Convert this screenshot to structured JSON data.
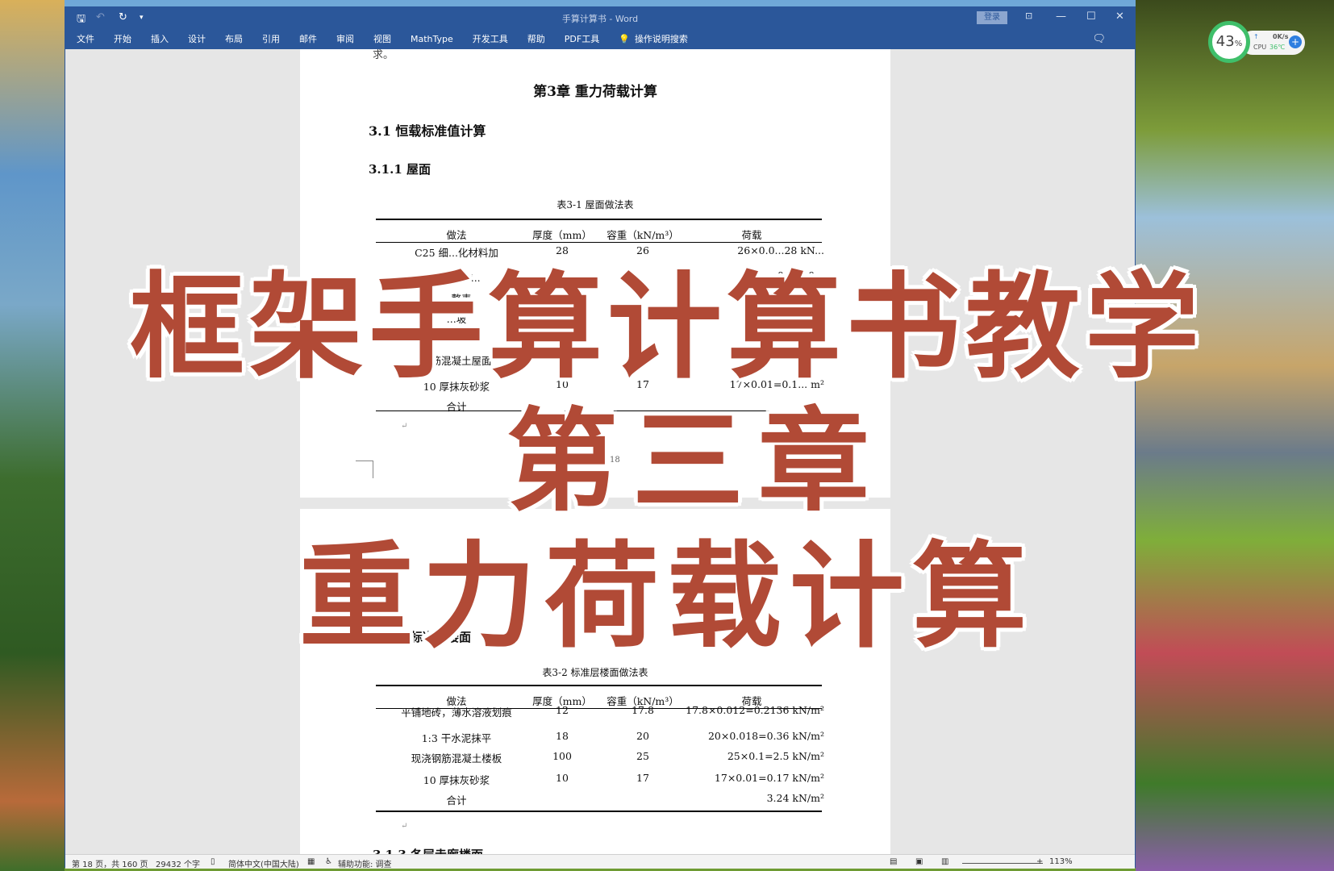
{
  "window": {
    "title": "手算计算书 - Word",
    "login": "登录"
  },
  "tabs": [
    "文件",
    "开始",
    "插入",
    "设计",
    "布局",
    "引用",
    "邮件",
    "审阅",
    "视图",
    "MathType",
    "开发工具",
    "帮助",
    "PDF工具"
  ],
  "tell_me": "操作说明搜索",
  "doc": {
    "prev_line": "求。",
    "chapter": "第3章 重力荷载计算",
    "s31": "3.1 恒载标准值计算",
    "s311": "3.1.1 屋面",
    "table1": {
      "caption": "表3-1 屋面做法表",
      "headers": [
        "做法",
        "厚度（mm）",
        "容重（kN/m³）",
        "荷载"
      ],
      "rows": [
        [
          "C25 细...化材料加",
          "28",
          "26",
          "26×0.0...28 kN..."
        ],
        [
          "...耐磨 T...",
          "",
          "",
          "0.36×0..."
        ],
        [
          "...整表",
          "",
          "",
          "...×0.0..."
        ],
        [
          "...坡",
          "",
          "...5",
          "19.5×0.03..."
        ],
        [
          "专用泡沫塑",
          "",
          "",
          "1..."
        ],
        [
          "...筋混凝土屋面",
          "",
          "25",
          "...=3 kN"
        ],
        [
          "10 厚抹灰砂浆",
          "10",
          "17",
          "17×0.01=0.1... m²"
        ],
        [
          "合计",
          "",
          "",
          ""
        ]
      ]
    },
    "page_number": "18",
    "s312": "3.1.2 标准层楼面",
    "table2": {
      "caption": "表3-2 标准层楼面做法表",
      "headers": [
        "做法",
        "厚度（mm）",
        "容重（kN/m³）",
        "荷载"
      ],
      "rows": [
        [
          "平铺地砖，薄水溶液划痕",
          "12",
          "17.8",
          "17.8×0.012=0.2136 kN/m²"
        ],
        [
          "1:3 干水泥抹平",
          "18",
          "20",
          "20×0.018=0.36 kN/m²"
        ],
        [
          "现浇钢筋混凝土楼板",
          "100",
          "25",
          "25×0.1=2.5 kN/m²"
        ],
        [
          "10 厚抹灰砂浆",
          "10",
          "17",
          "17×0.01=0.17 kN/m²"
        ],
        [
          "合计",
          "",
          "",
          "3.24 kN/m²"
        ]
      ]
    },
    "s313": "3.1.3 各层走廊楼面"
  },
  "status": {
    "page": "第 18 页，共 160 页",
    "words": "29432 个字",
    "lang": "简体中文(中国大陆)",
    "access": "辅助功能: 调查",
    "zoom": "113%"
  },
  "overlay": {
    "line1": "框架手算计算书教学",
    "line2": "第三章",
    "line3": "重力荷载计算",
    "color": "#b14a36"
  },
  "widget": {
    "percent": "43",
    "unit": "%",
    "net": "0K/s",
    "cpu_label": "CPU",
    "cpu_temp": "36℃"
  }
}
